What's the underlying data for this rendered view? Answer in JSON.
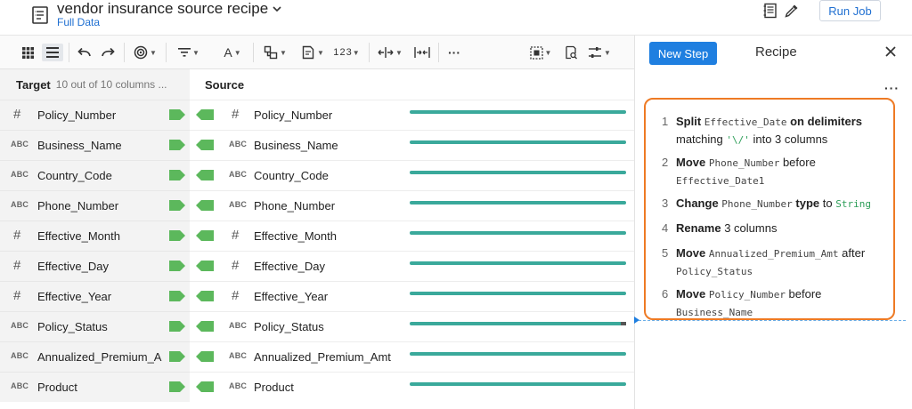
{
  "header": {
    "title": "vendor insurance source recipe",
    "subtitle": "Full Data",
    "run_job": "Run Job"
  },
  "toolbar": {
    "text_format_label": "A",
    "numeric_label": "1 2 3",
    "more_label": "···"
  },
  "grid": {
    "target_header": "Target",
    "target_count": "10 out of 10 columns ...",
    "source_header": "Source",
    "rows": [
      {
        "type": "#",
        "target": "Policy_Number",
        "source": "Policy_Number"
      },
      {
        "type": "ABC",
        "target": "Business_Name",
        "source": "Business_Name"
      },
      {
        "type": "ABC",
        "target": "Country_Code",
        "source": "Country_Code"
      },
      {
        "type": "ABC",
        "target": "Phone_Number",
        "source": "Phone_Number"
      },
      {
        "type": "#",
        "target": "Effective_Month",
        "source": "Effective_Month"
      },
      {
        "type": "#",
        "target": "Effective_Day",
        "source": "Effective_Day"
      },
      {
        "type": "#",
        "target": "Effective_Year",
        "source": "Effective_Year"
      },
      {
        "type": "ABC",
        "target": "Policy_Status",
        "source": "Policy_Status"
      },
      {
        "type": "ABC",
        "target": "Annualized_Premium_A",
        "source": "Annualized_Premium_Amt"
      },
      {
        "type": "ABC",
        "target": "Product",
        "source": "Product"
      }
    ],
    "bar_color": "#3aa99b",
    "connector_color": "#5cb85c"
  },
  "recipe": {
    "new_step": "New Step",
    "title": "Recipe",
    "more": "···",
    "steps": [
      {
        "n": "1",
        "parts": [
          [
            "b",
            "Split "
          ],
          [
            "m",
            "Effective_Date"
          ],
          [
            "b",
            " on delimiters"
          ],
          [
            "t",
            " matching "
          ],
          [
            "g",
            "'\\/'"
          ],
          [
            "t",
            " into 3 columns"
          ]
        ]
      },
      {
        "n": "2",
        "parts": [
          [
            "b",
            "Move "
          ],
          [
            "m",
            "Phone_Number"
          ],
          [
            "t",
            " before "
          ],
          [
            "m",
            "Effective_Date1"
          ]
        ]
      },
      {
        "n": "3",
        "parts": [
          [
            "b",
            "Change "
          ],
          [
            "m",
            "Phone_Number"
          ],
          [
            "b",
            " type"
          ],
          [
            "t",
            " to "
          ],
          [
            "g",
            "String"
          ]
        ]
      },
      {
        "n": "4",
        "parts": [
          [
            "b",
            "Rename"
          ],
          [
            "t",
            " 3 columns"
          ]
        ]
      },
      {
        "n": "5",
        "parts": [
          [
            "b",
            "Move "
          ],
          [
            "m",
            "Annualized_Premium_Amt"
          ],
          [
            "t",
            " after "
          ],
          [
            "m",
            "Policy_Status"
          ]
        ]
      },
      {
        "n": "6",
        "parts": [
          [
            "b",
            "Move "
          ],
          [
            "m",
            "Policy_Number"
          ],
          [
            "t",
            " before "
          ],
          [
            "m",
            "Business_Name"
          ]
        ]
      }
    ],
    "highlight_color": "#ee7a24",
    "button_color": "#1f7fe0"
  }
}
